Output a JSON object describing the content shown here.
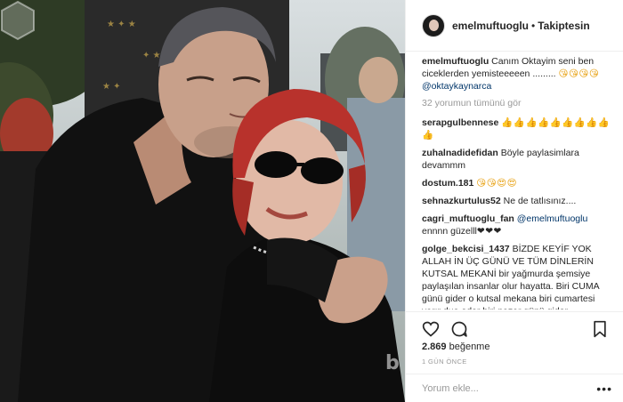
{
  "post": {
    "username": "emelmuftuoglu",
    "follow_status": "Takiptesin",
    "separator": "•",
    "caption": {
      "user": "emelmuftuoglu",
      "text": "Canım Oktayim seni ben ciceklerden yemisteeeeen .........",
      "emojis": "😘😘😘😘",
      "mention": "@oktaykaynarca"
    },
    "load_more": "32 yorumun tümünü gör",
    "comments": [
      {
        "user": "serapgulbennese",
        "text": "",
        "emojis": "👍👍👍👍👍👍👍👍👍👍"
      },
      {
        "user": "zuhalnadidefidan",
        "text": "Böyle paylasimlara devammm",
        "emojis": ""
      },
      {
        "user": "dostum.181",
        "text": "",
        "emojis": "😘😘😍😍"
      },
      {
        "user": "sehnazkurtulus52",
        "text": "Ne de tatlısınız....",
        "emojis": ""
      },
      {
        "user": "cagri_muftuoglu_fan",
        "mention": "@emelmuftuoglu",
        "text": "ennnn güzelll",
        "emojis": "❤❤❤"
      },
      {
        "user": "golge_bekcisi_1437",
        "text": "BİZDE KEYİF YOK ALLAH İN ÜÇ GÜNÜ VE TÜM DİNLERİN KUTSAL MEKANİ bir yağmurda şemsiye paylaşılan insanlar olur hayatta. Biri CUMA günü gider o kutsal mekana biri cumartesi varır dua eder biri pazar günü gider dualarında bulusur hepsi ALLAH A dönük",
        "emojis": ""
      }
    ],
    "likes_count": "2.869",
    "likes_label": "beğenme",
    "date": "1 GÜN ÖNCE",
    "comment_placeholder": "Yorum ekle...",
    "more_icon": "•••"
  },
  "icons": {
    "like": "heart-icon",
    "comment": "speech-bubble-icon",
    "save": "bookmark-icon",
    "more": "more-options-icon"
  },
  "watermark": "b",
  "colors": {
    "link": "#003569",
    "muted": "#999999",
    "text": "#262626",
    "border": "#efefef"
  }
}
